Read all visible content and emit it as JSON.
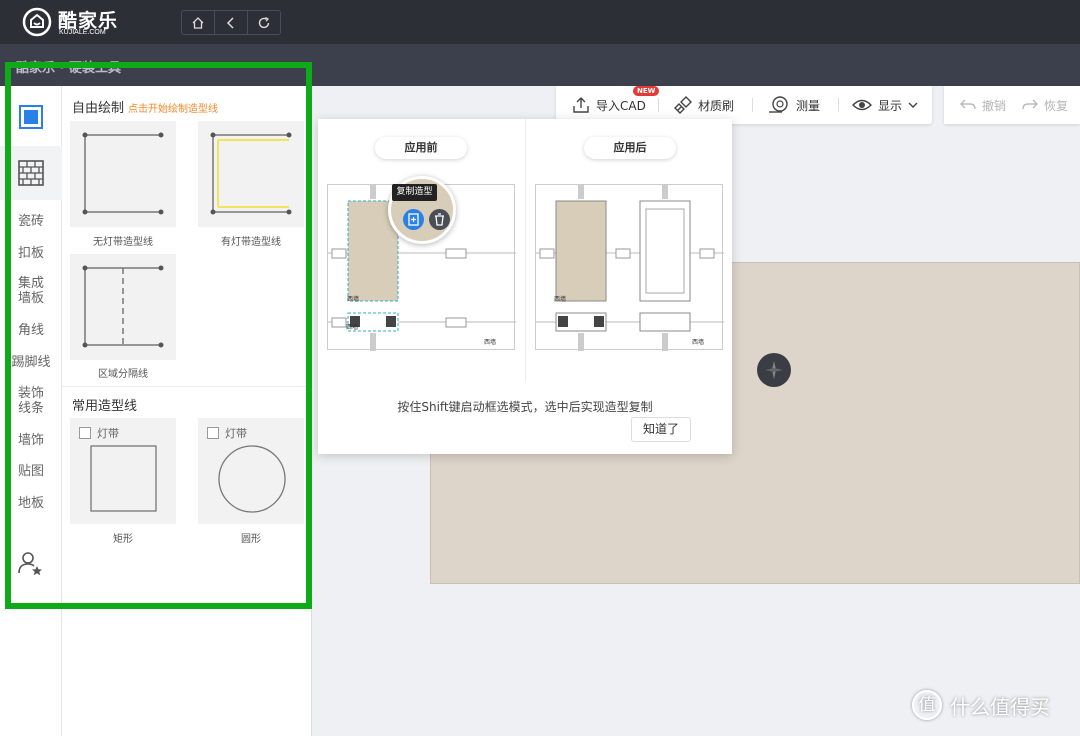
{
  "topbar": {
    "logo_text": "酷家乐",
    "logo_sub": "KUJIALE.COM"
  },
  "subbar": {
    "title": "酷家乐 · 硬装工具"
  },
  "sidebar": {
    "items": [
      "瓷砖",
      "扣板",
      "集成\n墙板",
      "角线",
      "踢脚线",
      "装饰\n线条",
      "墙饰",
      "贴图",
      "地板"
    ]
  },
  "panel": {
    "free_draw": {
      "title": "自由绘制",
      "hint": "点击开始绘制造型线"
    },
    "items": [
      {
        "label": "无灯带造型线"
      },
      {
        "label": "有灯带造型线"
      },
      {
        "label": "区域分隔线"
      }
    ],
    "common": {
      "title": "常用造型线"
    },
    "shapes": [
      {
        "checkbox_label": "灯带",
        "label": "矩形"
      },
      {
        "checkbox_label": "灯带",
        "label": "圆形"
      }
    ]
  },
  "toolbar": {
    "import_cad": "导入CAD",
    "new_badge": "NEW",
    "material_brush": "材质刷",
    "measure": "测量",
    "display": "显示",
    "undo": "撤销",
    "redo": "恢复"
  },
  "popup": {
    "before_label": "应用前",
    "after_label": "应用后",
    "tooltip": "复制造型",
    "plan_tag": "西墙",
    "description": "按住Shift键启动框选模式，选中后实现造型复制",
    "confirm": "知道了"
  },
  "watermark": {
    "icon": "值",
    "text": "什么值得买"
  },
  "colors": {
    "highlight": "#0faa17",
    "accent": "#2b80e8",
    "hint": "#f08a28"
  }
}
